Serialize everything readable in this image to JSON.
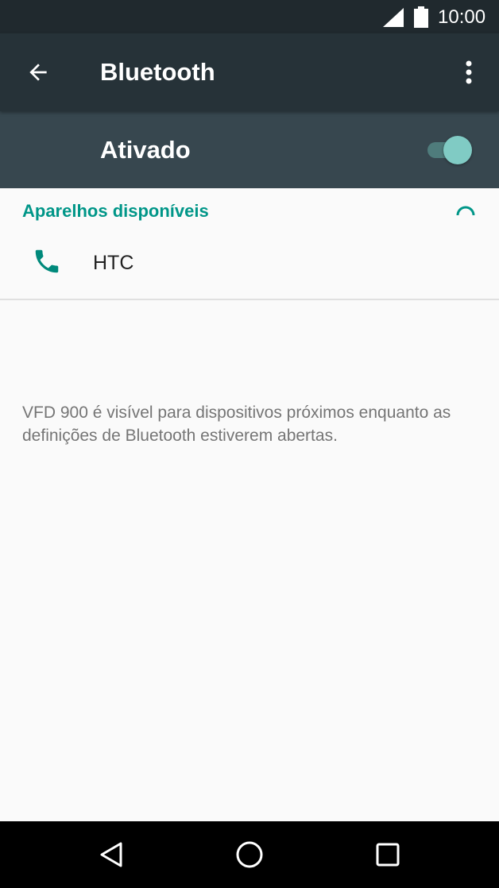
{
  "status_bar": {
    "time": "10:00",
    "signal_icon": "signal-icon",
    "battery_icon": "battery-icon"
  },
  "app_bar": {
    "title": "Bluetooth",
    "back_icon": "arrow-back-icon",
    "menu_icon": "more-vert-icon"
  },
  "bluetooth_switch": {
    "label": "Ativado",
    "enabled": true
  },
  "available_devices": {
    "header": "Aparelhos disponíveis",
    "scanning_icon": "progress-spinner-icon",
    "devices": [
      {
        "name": "HTC",
        "icon": "phone-icon"
      }
    ]
  },
  "visibility_text": "VFD 900 é visível para dispositivos próximos enquanto as definições de Bluetooth estiverem abertas.",
  "nav_bar": {
    "back_icon": "nav-back-icon",
    "home_icon": "nav-home-icon",
    "recents_icon": "nav-recents-icon"
  },
  "colors": {
    "status_bar_bg": "#20292e",
    "app_bar_bg": "#263238",
    "switch_bar_bg": "#37474f",
    "accent": "#009688",
    "toggle_thumb": "#80cbc4",
    "background": "#fafafa"
  }
}
